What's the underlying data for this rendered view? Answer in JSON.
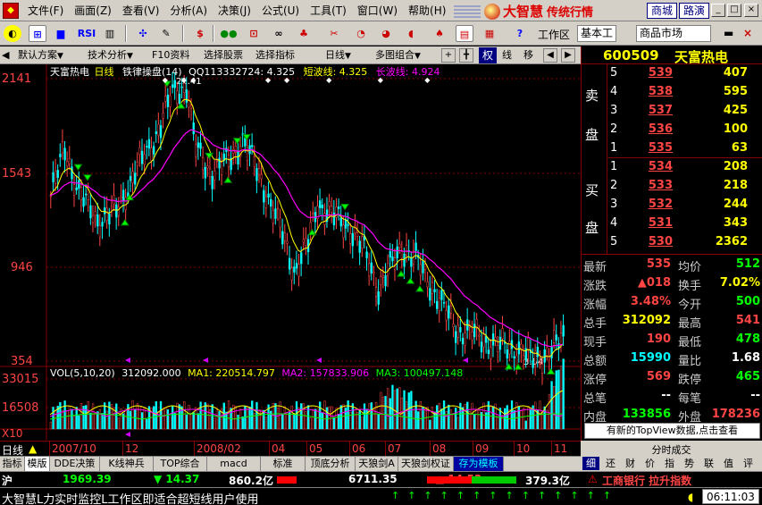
{
  "menu": [
    "文件(F)",
    "画面(Z)",
    "查看(V)",
    "分析(A)",
    "决策(J)",
    "公式(U)",
    "工具(T)",
    "窗口(W)",
    "帮助(H)"
  ],
  "brand": {
    "name": "大智慧",
    "subtitle": "传统行情",
    "market_btn": "商城",
    "road_btn": "路演"
  },
  "toolbar": {
    "workzone": "工作区",
    "basic": "基本工",
    "market": "商品市场"
  },
  "funcbar": [
    "默认方案",
    "技术分析",
    "F10资料",
    "选择股票",
    "选择指标",
    "日线",
    "多图组合"
  ],
  "funcbar_tabs": [
    "权",
    "线",
    "移"
  ],
  "chart_header": {
    "name": "天富热电",
    "period": "日线",
    "indicator": "铁律操盘(14)",
    "qq": "QQ113332724: 4.325",
    "short": "短波线: 4.325",
    "long": "长波线: 4.924"
  },
  "vol_header": {
    "label": "VOL(5,10,20)",
    "vol": "312092.000",
    "ma1": "MA1: 220514.797",
    "ma2": "MA2: 157833.906",
    "ma3": "MA3: 100497.148"
  },
  "chart_data": {
    "type": "candlestick",
    "title": "天富热电 日线",
    "y_ticks": [
      "2141",
      "1543",
      "946",
      "354"
    ],
    "vol_ticks": [
      "33015",
      "16508",
      "X10"
    ],
    "annotations": [
      "21.41",
      "3.54"
    ],
    "x_labels": [
      "2007/10",
      "12",
      "2008/02",
      "04",
      "05",
      "06",
      "07",
      "08",
      "09",
      "10",
      "11"
    ]
  },
  "quote": {
    "code": "600509",
    "name": "天富热电",
    "sell_label": [
      "卖",
      "盘"
    ],
    "buy_label": [
      "买",
      "盘"
    ],
    "sell": [
      {
        "idx": "5",
        "price": "539",
        "vol": "407"
      },
      {
        "idx": "4",
        "price": "538",
        "vol": "595"
      },
      {
        "idx": "3",
        "price": "537",
        "vol": "425"
      },
      {
        "idx": "2",
        "price": "536",
        "vol": "100"
      },
      {
        "idx": "1",
        "price": "535",
        "vol": "63"
      }
    ],
    "buy": [
      {
        "idx": "1",
        "price": "534",
        "vol": "208"
      },
      {
        "idx": "2",
        "price": "533",
        "vol": "218"
      },
      {
        "idx": "3",
        "price": "532",
        "vol": "244"
      },
      {
        "idx": "4",
        "price": "531",
        "vol": "343"
      },
      {
        "idx": "5",
        "price": "530",
        "vol": "2362"
      }
    ],
    "stats": [
      {
        "l1": "最新",
        "v1": "535",
        "c1": "red",
        "l2": "均价",
        "v2": "512",
        "c2": "green"
      },
      {
        "l1": "涨跌",
        "v1": "▲018",
        "c1": "red",
        "l2": "换手",
        "v2": "7.02%",
        "c2": "yellow"
      },
      {
        "l1": "涨幅",
        "v1": "3.48%",
        "c1": "red",
        "l2": "今开",
        "v2": "500",
        "c2": "green"
      },
      {
        "l1": "总手",
        "v1": "312092",
        "c1": "yellow",
        "l2": "最高",
        "v2": "541",
        "c2": "red"
      },
      {
        "l1": "现手",
        "v1": "190",
        "c1": "red",
        "l2": "最低",
        "v2": "478",
        "c2": "green"
      },
      {
        "l1": "总额",
        "v1": "15990",
        "c1": "cyan",
        "l2": "量比",
        "v2": "1.68",
        "c2": "white"
      },
      {
        "l1": "涨停",
        "v1": "569",
        "c1": "red",
        "l2": "跌停",
        "v2": "465",
        "c2": "green"
      },
      {
        "l1": "总笔",
        "v1": "--",
        "c1": "white",
        "l2": "每笔",
        "v2": "--",
        "c2": "white"
      },
      {
        "l1": "内盘",
        "v1": "133856",
        "c1": "green",
        "l2": "外盘",
        "v2": "178236",
        "c2": "red"
      }
    ],
    "banner": "有新的TopView数据,点击查看"
  },
  "right_tabs": {
    "title": "分时成交",
    "tabs": [
      "细",
      "还",
      "财",
      "价",
      "指",
      "势",
      "联",
      "值",
      "评"
    ]
  },
  "date_prefix": "日线",
  "bottom_tabs": [
    "指标",
    "模版",
    "DDE决策",
    "K线神兵",
    "TOP综合",
    "macd",
    "标准",
    "顶底分析",
    "天狼剑A",
    "天狼剑权证",
    "存为模板"
  ],
  "index_bar": {
    "market": "沪",
    "value": "1969.39",
    "change": "▼ 14.37",
    "amount": "860.2亿",
    "val2": "6711.35",
    "chg2": "▲ 14.52",
    "amt2": "379.3亿",
    "news": "工商银行 拉升指数"
  },
  "status": {
    "text": "大智慧L力实时监控L工作区即适合超短线用户使用",
    "time": "06:11:03"
  }
}
